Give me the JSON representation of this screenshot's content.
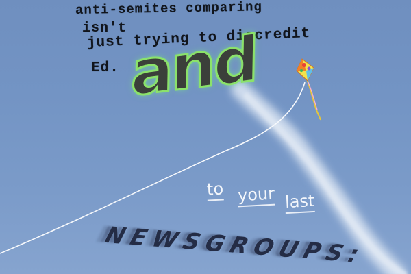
{
  "lines": [
    "anti-semites comparing",
    "isn't",
    "just trying to discredit",
    "Ed."
  ],
  "big_word": "and",
  "phrase": {
    "to": "to",
    "your": "your",
    "last": "last"
  },
  "newsgroups": "NEWSGROUPS:",
  "colors": {
    "sky": "#7394c4",
    "and_fill": "#3b3f3a",
    "and_outline": "#8be26a",
    "newsgroups": "#242c45",
    "phrase_text": "#f4f7fb"
  },
  "icons": {
    "kite": "kite-icon"
  }
}
